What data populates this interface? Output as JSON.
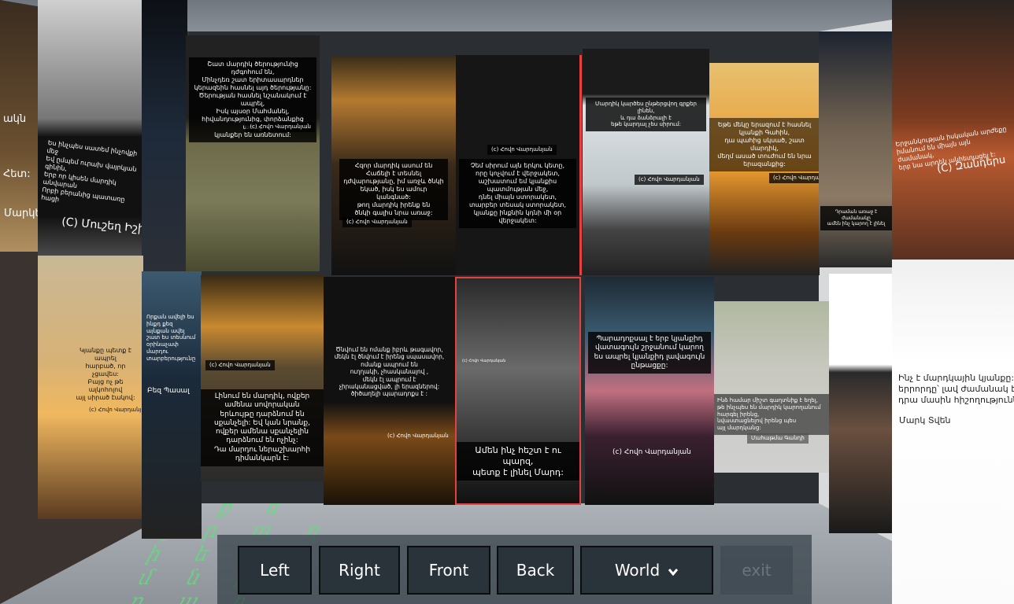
{
  "toolbar": {
    "left": "Left",
    "right": "Right",
    "front": "Front",
    "back": "Back",
    "world": "World",
    "world_icon": "chevron-down-icon",
    "exit": "exit"
  },
  "colors": {
    "highlight": "#e8403f",
    "matrix": "#5fe07a"
  },
  "panels": {
    "top": [
      {
        "quote": "Շատ մարդիկ ծերությունից դժգոհում են,\nՄինչդեռ շատ երիտասարդներ\nկերազեին հասնել այդ ծերությանը:\nԾերության հասնել նշանակում է ապրել,\nԻսկ այսօր Մահմանել,\nհիվանդությունից, փորձանքից առաջ\nկյանքեր են առնետում:",
        "author": "(c) Հովո Վարդանյան"
      },
      {
        "quote": "Հզոր մարդիկ ասում են\nՀաճելի է տեսնել\nդժվարությանը, իմ առջև ծնկի\nեկած, իսկ ես ամուր կանգնած:\nթող մարդիկ իրենք են\nծնկի գալիս նրա առաջ:",
        "author": "(c) Հովո Վարդանյան"
      },
      {
        "quote": "Չեմ սիրում այն երկու կետը,\nորը կոչվում է վերջակետ,\nաշխատում եմ կյանքիս\nպատմության մեջ,\nդնել միայն ստորակետ,\nտարբեր տեսակ ստորակետ,\nկյանքը ինքնին կդնի մի օր\nվերջակետ:",
        "author": "(c) Հովո Վարդանյան"
      },
      {
        "quote": "Մարդիկ կարծես ընթերցվող գրքեր լինեն,\nև դա ձանձրալի է\nեթե կարդալ չես սիրում:",
        "author": "(c) Հովո Վարդանյան"
      },
      {
        "quote": "Եթե մեկը երազում է հասնել\nկյանքի Գահին,\nդա պահից սկսած, շատ մարդիկ,\nմեղմ ասած տուժում են նրա\nերազանքից:",
        "author": "(c) Հովո Վարդանյան"
      }
    ],
    "bottom": [
      {
        "quote": "Լինում են մարդիկ, ովքեր\nամենա սովորական\nերևույթը դարձնում են\nսքանչելի: Եվ կան նրանք,\nովքեր ամենա սքանչելին\nդարձնում են ոչինչ:\nԴա մարդու ներաշխարհի\nդիմանկարն է:",
        "author": "(c) Հովո Վարդանյան"
      },
      {
        "quote": "Ծնվում են ոմանք իբրև թագավոր,\nմեկն էլ ծնվում է իրենց սպասավոր,\nոմանք ապրում են\nուղղակի, չհասկանալով ,\nմեկն էլ ապրում է\nչիրականացված, լի երազներով:\nծիծաղելի պարադոքս է :",
        "author": "(c) Հովո Վարդանյան"
      },
      {
        "quote": "Ամեն ինչ հեշտ է ու պարզ,\nպետք է լինել Մարդ:",
        "author": "(c) Հովո Վարդանյան"
      },
      {
        "quote": "Պարադոքսալ է երբ կյանքիդ\nվատագույն շրջանում կարող\nես ապրել կյանքիդ լավագույն\nընթացքը:",
        "author": "(c) Հովո Վարդանյան"
      },
      {
        "quote": "Ինձ համար միշտ գաղտնիք է եղել,\nթե ինչպես են մարդիկ կարողանում\nհարգել իրենց,\nնվաստացնելով իրենց պես\nայլ մարդկանց:",
        "author": "Մահաթմա Գանդի"
      }
    ],
    "left": [
      {
        "quote": "Ես ինչպես սատեմ ինչովքի մեջ\nԵվ ըմպեմ ուրախ վայրկյան գինին,\nԵրբ որ կիսեն մարդիկ անվարան\nՈրբի բերանից պատառը հացի",
        "author": "(C) Մուշեղ Իշխան"
      },
      {
        "quote": "Կյանքը պետք է ապրել\nհարբած, որ չցավես:\nԲայց ոչ թե ալկոհոլով\nայլ սիրած էակով:",
        "author": "(c) Հովո Վարդանյան"
      },
      {
        "quote": "Որքան ավելի ես ինքդ քեզ\nայնքան ավել շատ ես տեսնում\nօրինաչափ մարդու\nտարբերությունը",
        "author": "Բեզ Պասալ"
      },
      {
        "quote": "ակն",
        "author": "Մարկես"
      },
      {
        "quote": "Հետ:",
        "author": ""
      }
    ],
    "right": [
      {
        "quote": "Երջանկության իսկական արժեքը\nիմանում են միայն այն ժամանակ,\nերբ նա արդեն անհետացել է:",
        "author": "(C) Զանդերս"
      },
      {
        "quote": "Ինչ է մարդկային կյանքը: Սկզ\nերրորդը՝ լավ ժամանակ է, մն\nդրա մասին հիշողություններ:",
        "author": "Մարկ Տվեն"
      },
      {
        "quote": "Դրաման առաջ է ժամանակը\nամեն ինչ կարող է լինել",
        "author": ""
      }
    ]
  }
}
